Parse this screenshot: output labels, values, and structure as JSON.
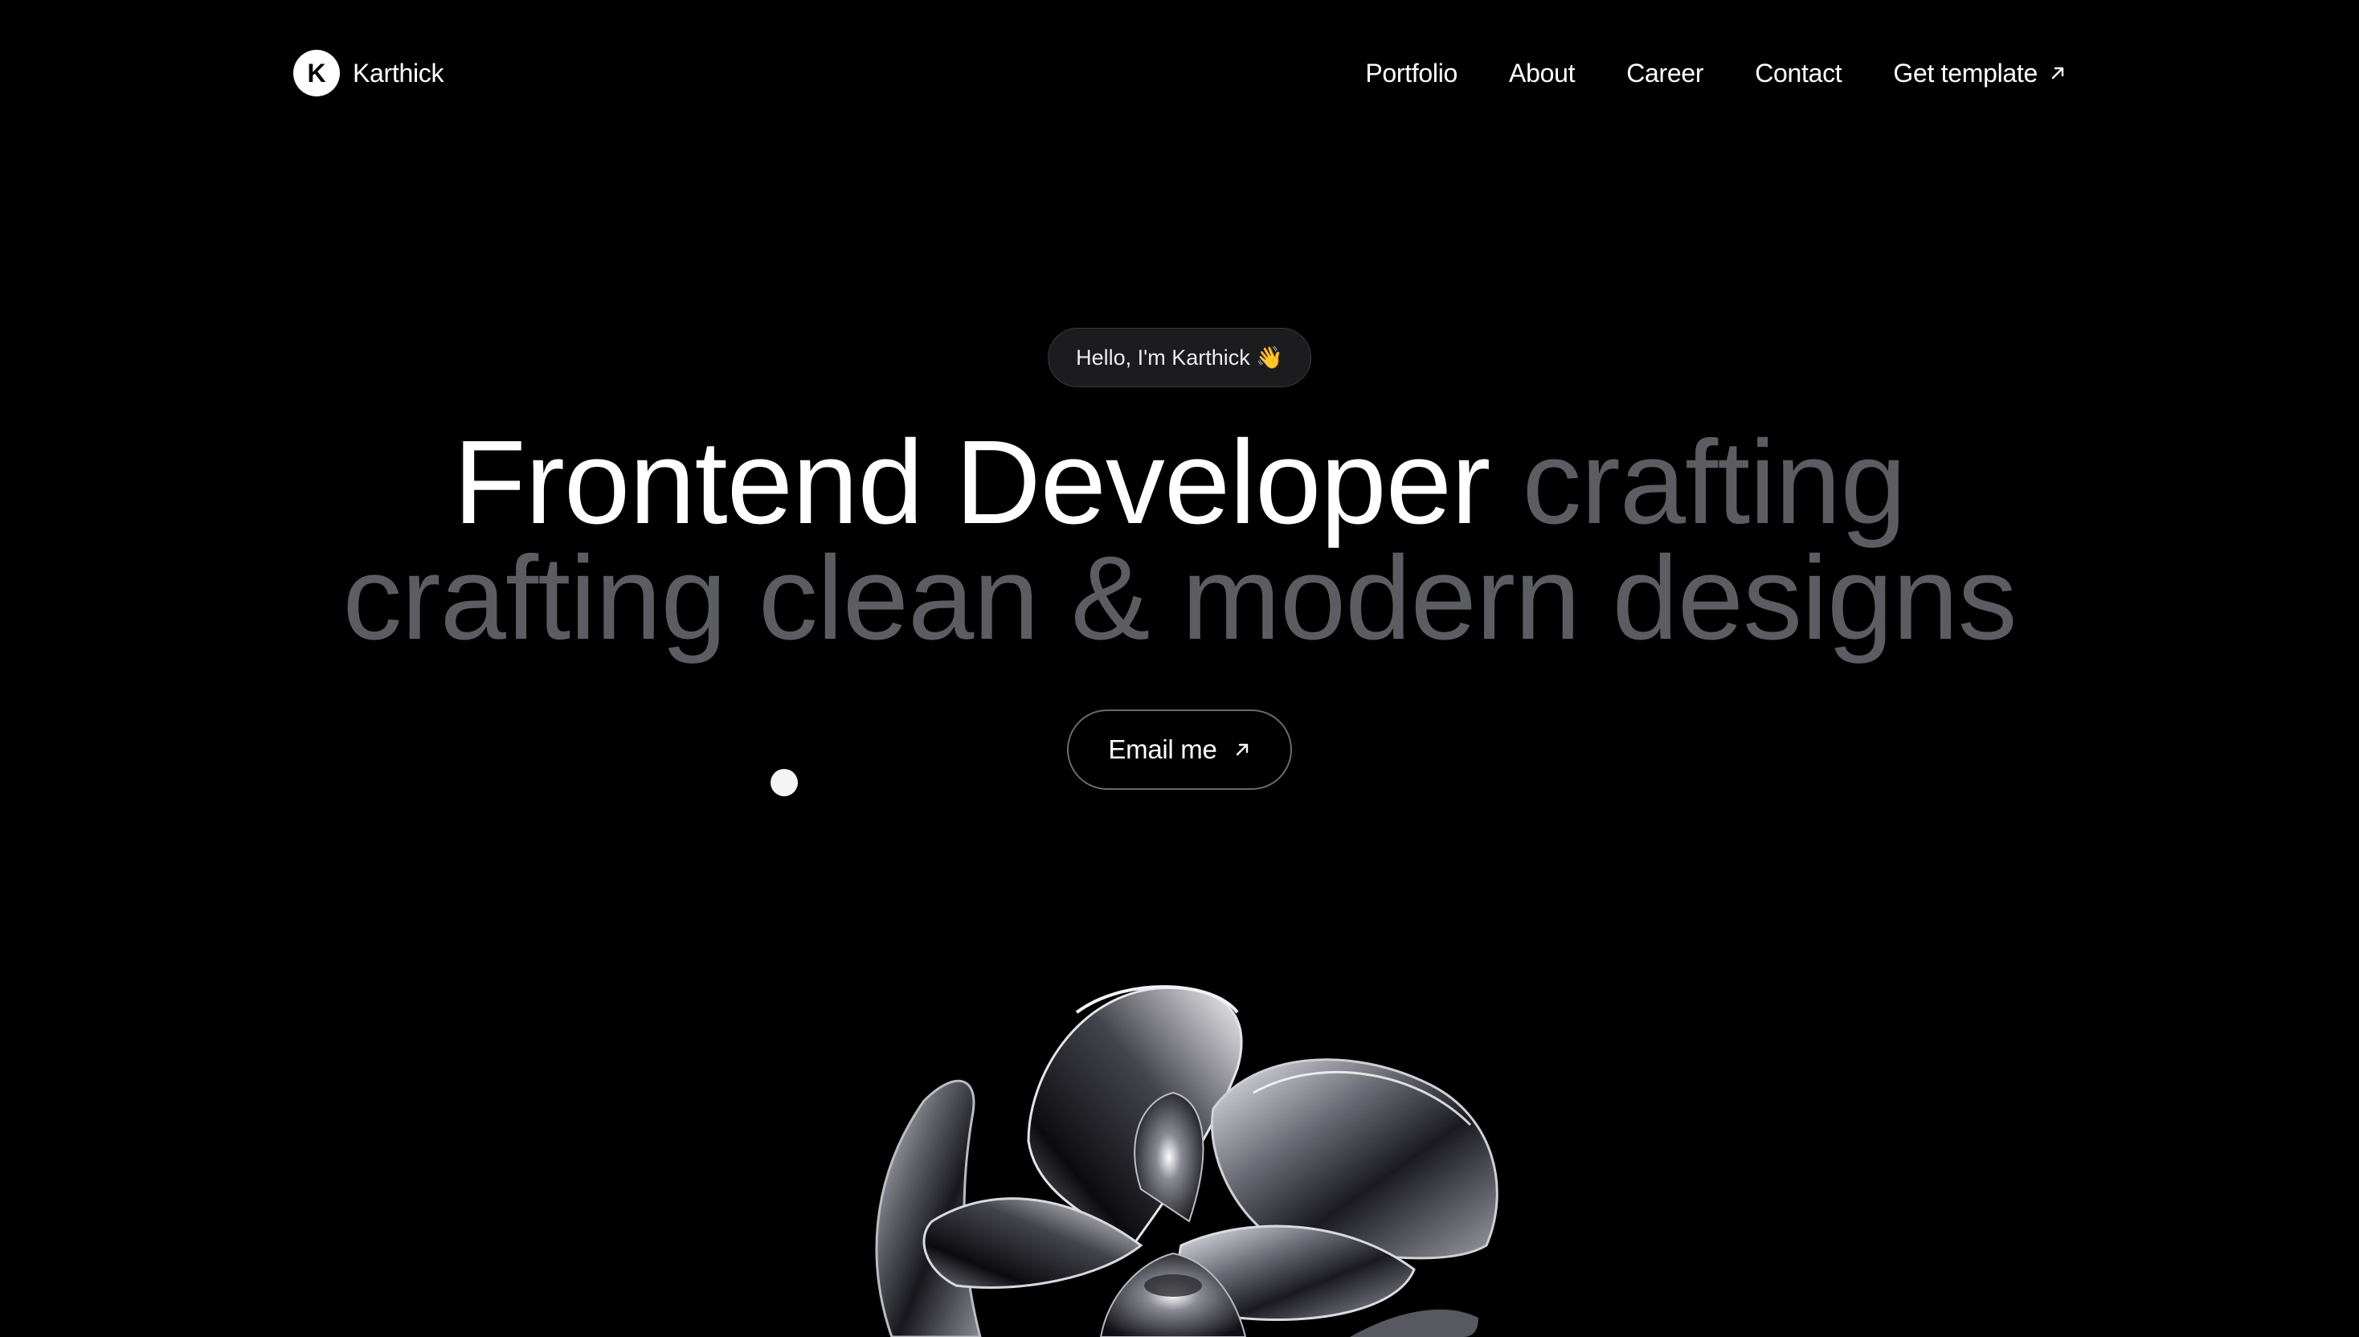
{
  "brand": {
    "logo_letter": "K",
    "name": "Karthick"
  },
  "nav": {
    "items": [
      {
        "label": "Portfolio"
      },
      {
        "label": "About"
      },
      {
        "label": "Career"
      },
      {
        "label": "Contact"
      },
      {
        "label": "Get template",
        "icon": "arrow-up-right-icon"
      }
    ]
  },
  "hero": {
    "greeting": "Hello, I'm Karthick 👋",
    "headline_line1_white": "Frontend Developer",
    "headline_line1_gray": "crafting",
    "headline_line2_gray": "crafting clean & modern designs",
    "cta_label": "Email me",
    "cta_icon": "arrow-up-right-icon"
  },
  "colors": {
    "background": "#000000",
    "text_primary": "#ffffff",
    "text_muted": "#5c5c63",
    "pill_background": "#1c1c1f"
  },
  "decor": {
    "image": "chrome-glass-flower-3d-render"
  }
}
